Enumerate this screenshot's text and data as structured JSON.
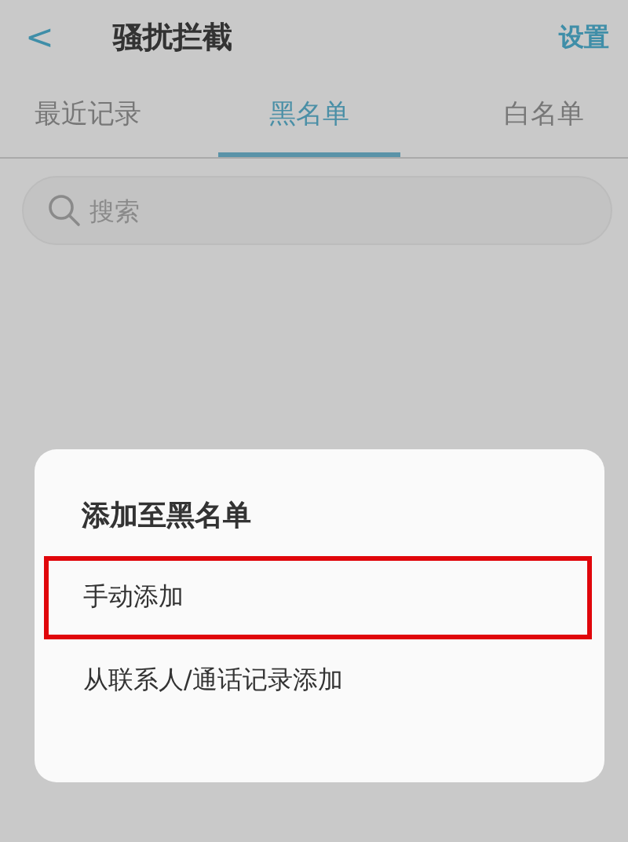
{
  "header": {
    "back": "<",
    "title": "骚扰拦截",
    "action": "设置"
  },
  "tabs": [
    {
      "label": "最近记录",
      "selected": false
    },
    {
      "label": "黑名单",
      "selected": true
    },
    {
      "label": "白名单",
      "selected": false
    }
  ],
  "search": {
    "placeholder": "搜索"
  },
  "dialog": {
    "title": "添加至黑名单",
    "options": [
      {
        "label": "手动添加",
        "highlighted": true
      },
      {
        "label": "从联系人/通话记录添加",
        "highlighted": false
      }
    ]
  }
}
